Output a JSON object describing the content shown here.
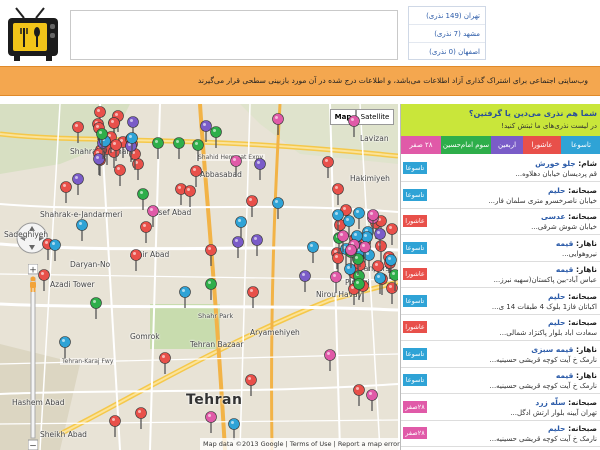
{
  "header": {
    "cities": [
      {
        "name": "تهران",
        "count": "(149 نذری)"
      },
      {
        "name": "مشهد",
        "count": "(7 نذری)"
      },
      {
        "name": "اصفهان",
        "count": "(0 نذری)"
      }
    ]
  },
  "notice": "وب‌سایتی اجتماعی برای اشتراک گذاری آزاد اطلاعات می‌باشد، و اطلاعات درج شده در آن مورد بازبینی سطحی قرار می‌گیرند",
  "map": {
    "maptype_map": "Map",
    "maptype_satellite": "Satellite",
    "city_label": "Tehran",
    "labels": [
      {
        "id": "shahrak-e-gharb",
        "text": "Shahrak-e-Gharb"
      },
      {
        "id": "abbasabad",
        "text": "Abbasabad"
      },
      {
        "id": "shahrak-e-jandarmeri",
        "text": "Shahrak-e-Jandarmeri"
      },
      {
        "id": "yusef-abad",
        "text": "Yusef Abad"
      },
      {
        "id": "sadeghiyeh",
        "text": "Sadeghiyeh"
      },
      {
        "id": "amir-abad",
        "text": "Amir Abad"
      },
      {
        "id": "daryan-no",
        "text": "Daryan-No"
      },
      {
        "id": "tehranpars",
        "text": "Tehranpars"
      },
      {
        "id": "piroozi",
        "text": "Piroozi"
      },
      {
        "id": "nirou-havayi",
        "text": "Nirou Havayi"
      },
      {
        "id": "azadi-tower",
        "text": "Azadi Tower"
      },
      {
        "id": "shahr-park",
        "text": "Shahr Park"
      },
      {
        "id": "gomrok",
        "text": "Gomrok"
      },
      {
        "id": "tehran-bazaar",
        "text": "Tehran Bazaar"
      },
      {
        "id": "aryamehiyeh",
        "text": "Aryamehiyeh"
      },
      {
        "id": "hashem-abad",
        "text": "Hashem Abad"
      },
      {
        "id": "sheikh-abad",
        "text": "Sheikh Abad"
      },
      {
        "id": "lavizan",
        "text": "Lavizan"
      },
      {
        "id": "hakimiyeh",
        "text": "Hakimiyeh"
      }
    ],
    "roads": [
      {
        "id": "shahid-hemmat-exp",
        "text": "Shahid Hemmat Expy"
      },
      {
        "id": "tehran-karaj-fwy",
        "text": "Tehran-Karaj Fwy"
      }
    ],
    "footer": "Map data ©2013 Google  |  Terms of Use  |  Report a map error"
  },
  "side": {
    "title": "شما هم نذری می‌دین یا گرفتین؟",
    "subtitle": "در لیست نذری‌های ما ثبتش کنید!",
    "filters": [
      {
        "label": "تاسوعا",
        "color": "#2fa3d6"
      },
      {
        "label": "عاشورا",
        "color": "#e8504a"
      },
      {
        "label": "اربعین",
        "color": "#7a5cc8"
      },
      {
        "label": "سوم امام‌حسین",
        "color": "#2eae4a"
      },
      {
        "label": "۲۸ صفر",
        "color": "#e05aa8"
      }
    ],
    "rows": [
      {
        "time": "شام:",
        "name": "جلو خورش",
        "addr": "قم پردیسان خیابان دهلاوه...",
        "badge": "تاسوعا",
        "color": "#2fa3d6"
      },
      {
        "time": "صبحانه:",
        "name": "حلیم",
        "addr": "خیابان ناصرخسرو متری سلمان فار...",
        "badge": "تاسوعا",
        "color": "#2fa3d6"
      },
      {
        "time": "صبحانه:",
        "name": "عدسی",
        "addr": "خیابان شوش شرقی...",
        "badge": "عاشورا",
        "color": "#e8504a"
      },
      {
        "time": "ناهار:",
        "name": "قیمه",
        "addr": "نیروهوایی...",
        "badge": "تاسوعا",
        "color": "#2fa3d6"
      },
      {
        "time": "ناهار:",
        "name": "قیمه",
        "addr": "عباس آباد-بین پاکستان(سهیه نبرز...",
        "badge": "عاشورا",
        "color": "#e8504a"
      },
      {
        "time": "صبحانه:",
        "name": "حلیم",
        "addr": "اکباتان فاز1 بلوک 4 طبقات 14 ی...",
        "badge": "تاسوعا",
        "color": "#2fa3d6"
      },
      {
        "time": "صبحانه:",
        "name": "حلیم",
        "addr": "سعادت اباد بلوار پاکنژاد شمالی...",
        "badge": "عاشورا",
        "color": "#e8504a"
      },
      {
        "time": "ناهار:",
        "name": "قیمه سبزی",
        "addr": "نارمک خ آیت کوچه قریشی حسینیه...",
        "badge": "تاسوعا",
        "color": "#2fa3d6"
      },
      {
        "time": "ناهار:",
        "name": "قیمه",
        "addr": "نارمک خ آیت کوچه قریشی حسینیه...",
        "badge": "تاسوعا",
        "color": "#2fa3d6"
      },
      {
        "time": "صبحانه:",
        "name": "سلّه زرد",
        "addr": "تهران آیینه بلوار ارتش ادگل...",
        "badge": "۲۸صفر",
        "color": "#e05aa8"
      },
      {
        "time": "صبحانه:",
        "name": "حلیم",
        "addr": "نارمک خ آیت کوچه قریشی حسینیه...",
        "badge": "۲۸صفر",
        "color": "#e05aa8"
      }
    ]
  },
  "markers": [
    {
      "c": "#e8504a",
      "n": 60
    },
    {
      "c": "#7a5cc8",
      "n": 12
    },
    {
      "c": "#2fa3d6",
      "n": 22
    },
    {
      "c": "#2eae4a",
      "n": 14
    },
    {
      "c": "#e05aa8",
      "n": 14
    }
  ]
}
